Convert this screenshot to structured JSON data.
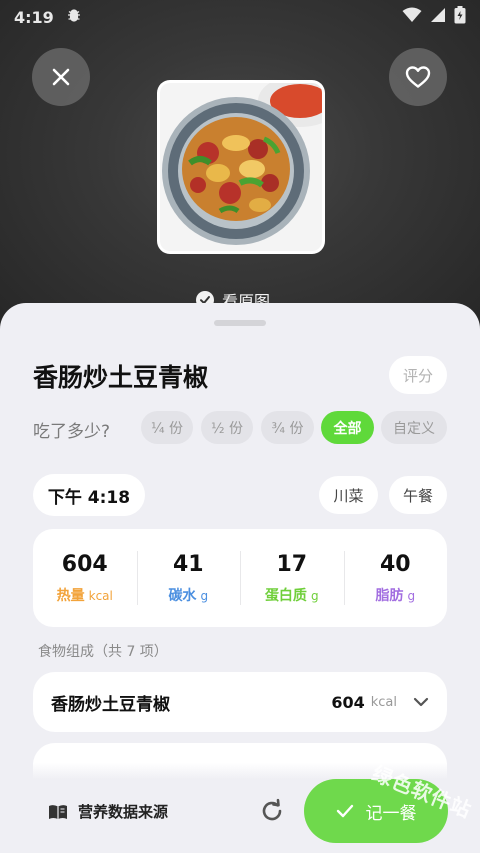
{
  "status_bar": {
    "time": "4:19"
  },
  "photo": {
    "view_original_label": "看原图"
  },
  "dish": {
    "title": "香肠炒土豆青椒",
    "rate_label": "评分"
  },
  "portion": {
    "label": "吃了多少?",
    "options": [
      "¼ 份",
      "½ 份",
      "¾ 份",
      "全部",
      "自定义"
    ],
    "selected": "全部"
  },
  "meal": {
    "time": "下午 4:18",
    "cuisine": "川菜",
    "meal_type": "午餐"
  },
  "nutrition": [
    {
      "value": "604",
      "name": "热量",
      "unit": "kcal",
      "color": "#f2a33a"
    },
    {
      "value": "41",
      "name": "碳水",
      "unit": "g",
      "color": "#4b8fe0"
    },
    {
      "value": "17",
      "name": "蛋白质",
      "unit": "g",
      "color": "#6fcf3a"
    },
    {
      "value": "40",
      "name": "脂肪",
      "unit": "g",
      "color": "#a26ee0"
    }
  ],
  "composition": {
    "label": "食物组成（共 7 项）",
    "items": [
      {
        "name": "香肠炒土豆青椒",
        "calories": "604",
        "unit": "kcal"
      }
    ]
  },
  "footer": {
    "source_label": "营养数据来源",
    "record_label": "记一餐"
  },
  "watermark": {
    "text": "绿色软件站"
  },
  "colors": {
    "accent": "#6fd94c",
    "active_chip": "#5fd93a",
    "sheet_bg": "#efeff4"
  }
}
